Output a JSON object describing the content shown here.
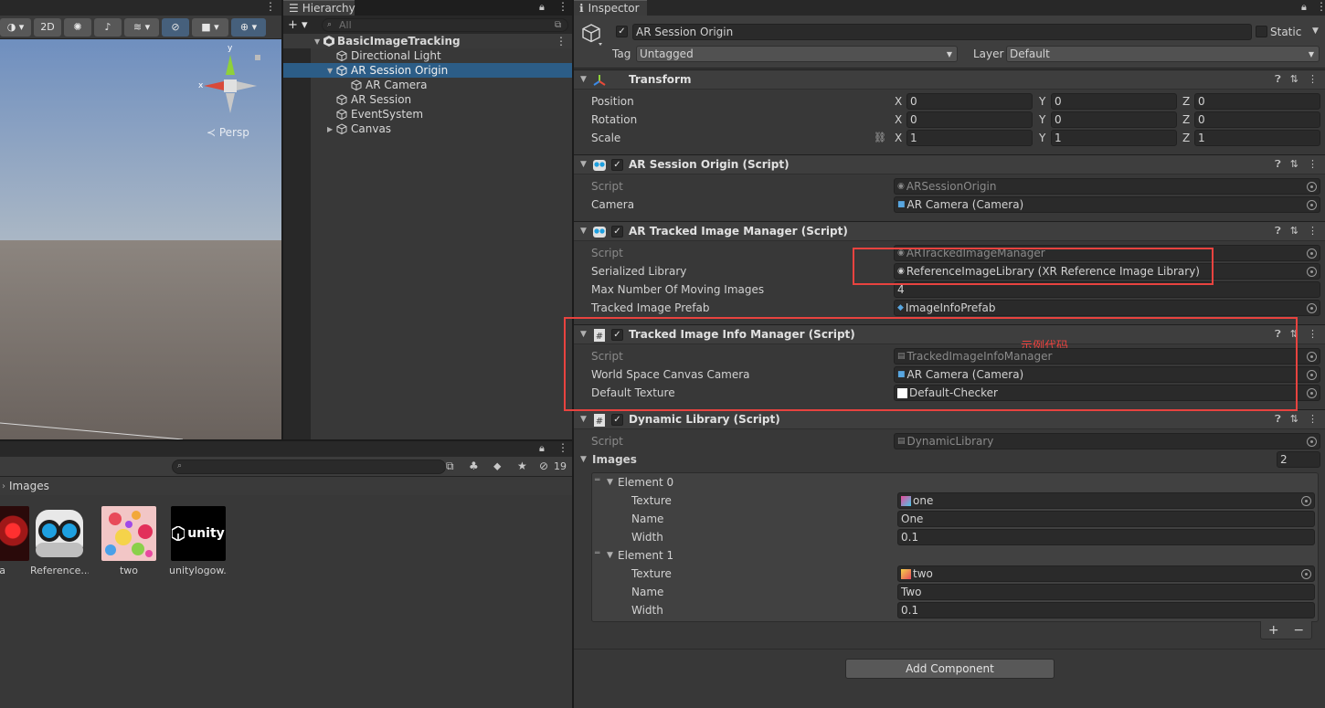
{
  "scene": {
    "mode_2d": "2D",
    "persp_label": "≺ Persp",
    "gizmo_y": "y",
    "gizmo_x": "x"
  },
  "hierarchy": {
    "tab_label": "Hierarchy",
    "add_label": "+ ▾",
    "search_placeholder": "All",
    "items": [
      {
        "label": "BasicImageTracking"
      },
      {
        "label": "Directional Light"
      },
      {
        "label": "AR Session Origin"
      },
      {
        "label": "AR Camera"
      },
      {
        "label": "AR Session"
      },
      {
        "label": "EventSystem"
      },
      {
        "label": "Canvas"
      }
    ]
  },
  "project": {
    "breadcrumb": "Images",
    "hidden_count": "19",
    "assets": [
      {
        "label": "ia"
      },
      {
        "label": "Reference..."
      },
      {
        "label": "two"
      },
      {
        "label": "unitylogow..."
      }
    ],
    "unity_logo_text": "unity"
  },
  "inspector": {
    "tab_label": "Inspector",
    "object_name": "AR Session Origin",
    "static_label": "Static",
    "tag_label": "Tag",
    "tag_value": "Untagged",
    "layer_label": "Layer",
    "layer_value": "Default",
    "transform": {
      "title": "Transform",
      "position_label": "Position",
      "rotation_label": "Rotation",
      "scale_label": "Scale",
      "axis_x": "X",
      "axis_y": "Y",
      "axis_z": "Z",
      "position": [
        "0",
        "0",
        "0"
      ],
      "rotation": [
        "0",
        "0",
        "0"
      ],
      "scale": [
        "1",
        "1",
        "1"
      ]
    },
    "ar_session_origin": {
      "title": "AR Session Origin (Script)",
      "script_label": "Script",
      "script_value": "ARSessionOrigin",
      "camera_label": "Camera",
      "camera_value": "AR Camera (Camera)"
    },
    "ar_tracked_image_manager": {
      "title": "AR Tracked Image Manager (Script)",
      "script_label": "Script",
      "script_value": "ARTrackedImageManager",
      "serialized_library_label": "Serialized Library",
      "serialized_library_value": "ReferenceImageLibrary (XR Reference Image Library)",
      "max_images_label": "Max Number Of Moving Images",
      "max_images_value": "4",
      "prefab_label": "Tracked Image Prefab",
      "prefab_value": "ImageInfoPrefab"
    },
    "tracked_image_info_manager": {
      "title": "Tracked Image Info Manager (Script)",
      "annotation": "示例代码",
      "script_label": "Script",
      "script_value": "TrackedImageInfoManager",
      "canvas_camera_label": "World Space Canvas Camera",
      "canvas_camera_value": "AR Camera (Camera)",
      "default_texture_label": "Default Texture",
      "default_texture_value": "Default-Checker"
    },
    "dynamic_library": {
      "title": "Dynamic Library (Script)",
      "script_label": "Script",
      "script_value": "DynamicLibrary",
      "images_label": "Images",
      "images_count": "2",
      "elements": [
        {
          "header": "Element 0",
          "texture_label": "Texture",
          "texture_value": "one",
          "name_label": "Name",
          "name_value": "One",
          "width_label": "Width",
          "width_value": "0.1"
        },
        {
          "header": "Element 1",
          "texture_label": "Texture",
          "texture_value": "two",
          "name_label": "Name",
          "name_value": "Two",
          "width_label": "Width",
          "width_value": "0.1"
        }
      ],
      "add_symbol": "+",
      "remove_symbol": "−"
    },
    "add_component_label": "Add Component"
  }
}
